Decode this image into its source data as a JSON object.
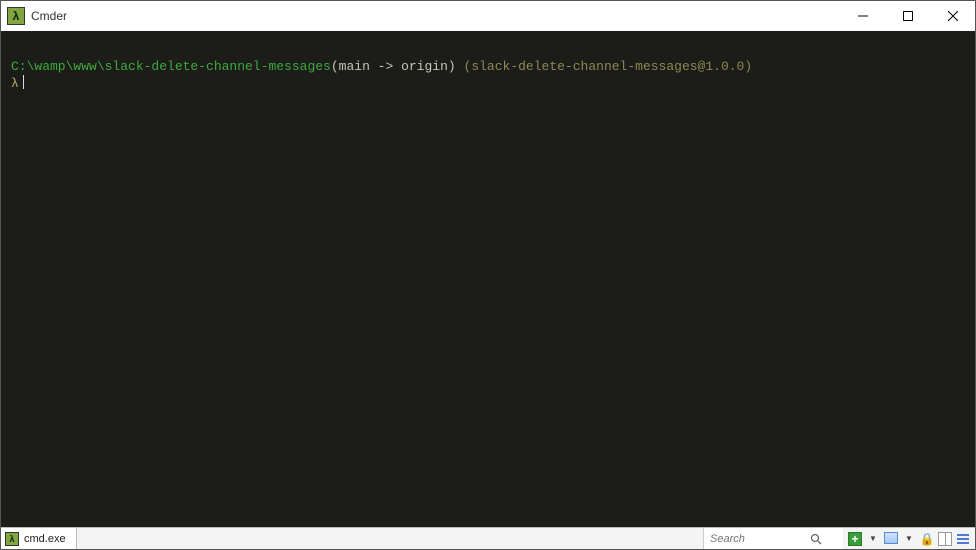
{
  "titlebar": {
    "app_icon_glyph": "λ",
    "title": "Cmder"
  },
  "terminal": {
    "path": "C:\\wamp\\www\\slack-delete-channel-messages",
    "branch_open": "(",
    "branch_text": "main -> origin",
    "branch_close": ")",
    "package_text": "(slack-delete-channel-messages@1.0.0)",
    "prompt_glyph": "λ"
  },
  "tabs": [
    {
      "icon_glyph": "λ",
      "label": "cmd.exe"
    }
  ],
  "search": {
    "placeholder": "Search"
  }
}
